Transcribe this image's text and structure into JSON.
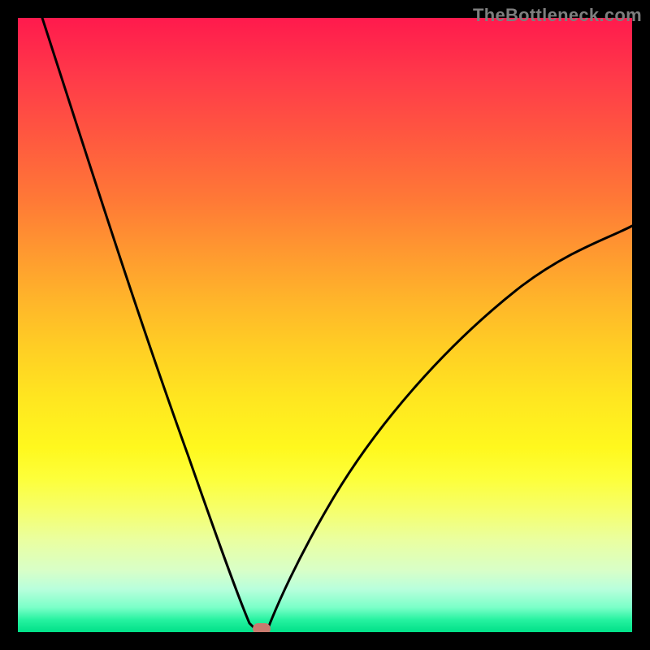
{
  "watermark": "TheBottleneck.com",
  "colors": {
    "frame_bg": "#000000",
    "gradient_top": "#ff1a4d",
    "gradient_bottom": "#00e088",
    "curve": "#000000",
    "marker": "#c97a6e",
    "watermark_text": "#7e7e7e"
  },
  "chart_data": {
    "type": "line",
    "title": "",
    "xlabel": "",
    "ylabel": "",
    "xlim": [
      0,
      100
    ],
    "ylim": [
      0,
      100
    ],
    "series": [
      {
        "name": "bottleneck-curve",
        "x": [
          4,
          8,
          12,
          16,
          20,
          24,
          28,
          32,
          35,
          37,
          38.5,
          40.5,
          42,
          45,
          50,
          56,
          63,
          71,
          80,
          90,
          100
        ],
        "y": [
          100,
          89,
          78,
          67,
          56,
          45,
          34,
          22,
          11,
          4,
          0.3,
          0.3,
          2,
          7,
          14,
          22,
          31,
          40,
          49,
          58,
          66
        ]
      }
    ],
    "annotations": {
      "marker_optimal": {
        "x": 39.7,
        "y": 0.3
      }
    },
    "notes": "V-shaped curve on a rainbow heat gradient; minimum marks the optimal (no-bottleneck) point."
  }
}
